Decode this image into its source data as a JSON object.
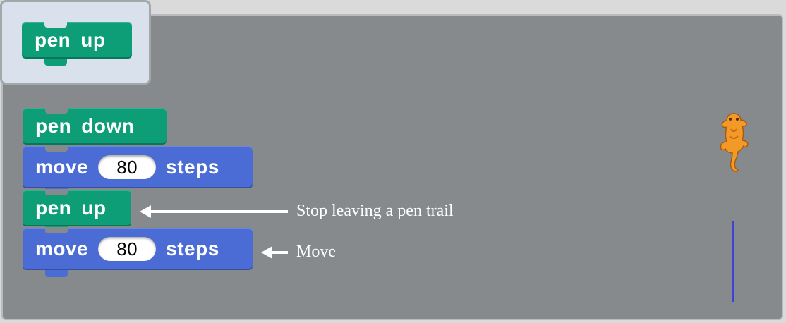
{
  "palette": {
    "block_label": [
      "pen",
      "up"
    ]
  },
  "script": {
    "blocks": [
      {
        "kind": "pen",
        "words": [
          "pen",
          "down"
        ]
      },
      {
        "kind": "motion",
        "before": "move",
        "value": "80",
        "after": "steps"
      },
      {
        "kind": "pen",
        "words": [
          "pen",
          "up"
        ]
      },
      {
        "kind": "motion",
        "before": "move",
        "value": "80",
        "after": "steps"
      }
    ]
  },
  "annotations": {
    "pen_up": "Stop leaving a pen trail",
    "move": "Move"
  },
  "stage": {
    "sprite_icon": "dragon-sprite-icon",
    "trail_color": "#3b43d9"
  },
  "colors": {
    "pen_block": "#0d9e78",
    "motion_block": "#4a6cd4",
    "scripts_background": "#868a8d",
    "palette_background": "#d9e2ec"
  }
}
